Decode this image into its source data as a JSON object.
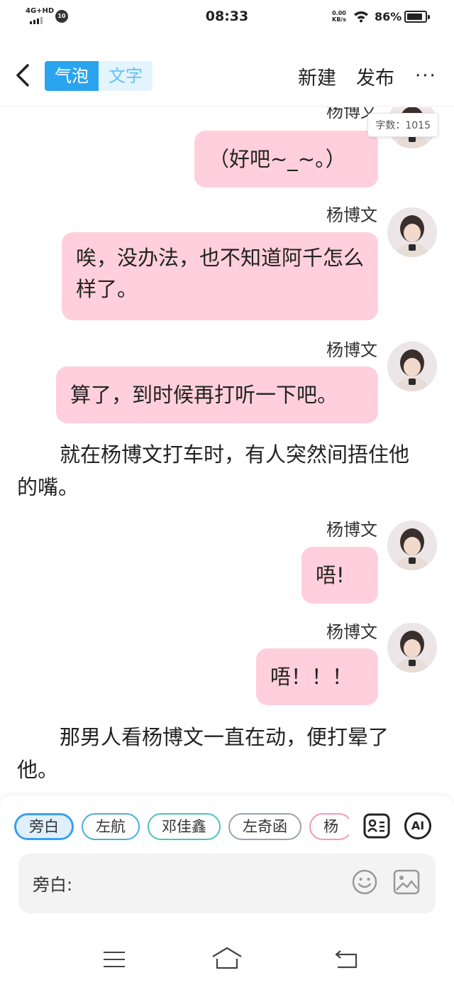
{
  "status_bar": {
    "network": "4G+HD",
    "notification_count": "10",
    "time": "08:33",
    "speed_value": "0.00",
    "speed_unit": "KB/s",
    "battery": "86%"
  },
  "app_bar": {
    "tab_bubble": "气泡",
    "tab_text": "文字",
    "new_label": "新建",
    "publish_label": "发布",
    "more_label": "···"
  },
  "word_count": "字数：1015",
  "chat": {
    "partial_name": "杨博文",
    "partial_bubble": "（好吧~_~。）",
    "messages": [
      {
        "name": "杨博文",
        "text": "唉，没办法，也不知道阿千怎么样了。"
      },
      {
        "name": "杨博文",
        "text": "算了，到时候再打听一下吧。"
      },
      {
        "name": "杨博文",
        "text": "唔!"
      },
      {
        "name": "杨博文",
        "text": "唔！！！"
      }
    ],
    "narrations": [
      "就在杨博文打车时，有人突然间捂住他的嘴。",
      "那男人看杨博文一直在动，便打晕了他。"
    ]
  },
  "composer": {
    "chips": [
      "旁白",
      "左航",
      "邓佳鑫",
      "左奇函",
      "杨"
    ],
    "input_label": "旁白:",
    "ai_label": "AI"
  },
  "colors": {
    "accent": "#2aa4ee",
    "bubble": "#ffcfdd"
  },
  "icons": [
    "back-arrow-icon",
    "more-icon",
    "character-card-icon",
    "ai-icon",
    "emoji-icon",
    "image-icon",
    "menu-icon",
    "home-icon",
    "return-icon"
  ]
}
